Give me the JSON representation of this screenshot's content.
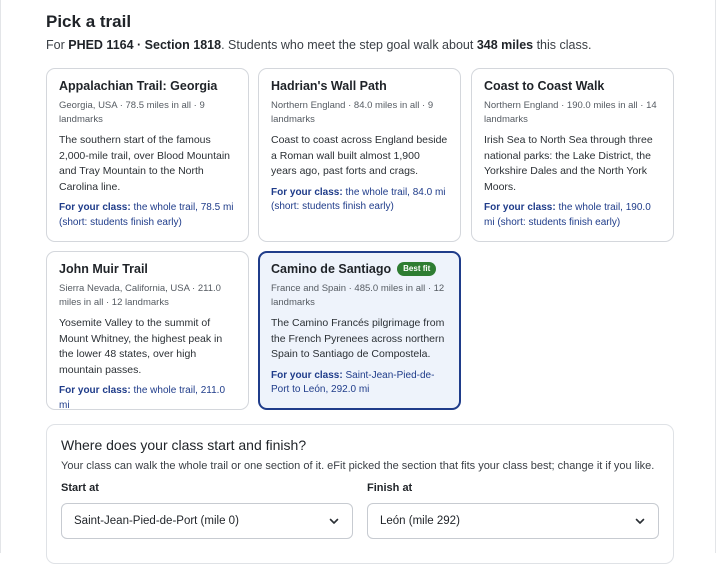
{
  "header": {
    "title": "Pick a trail",
    "sub_prefix": "For ",
    "course": "PHED 1164 · Section 1818",
    "sub_middle": ". Students who meet the step goal walk about ",
    "miles": "348 miles",
    "sub_suffix": " this class."
  },
  "trails": [
    {
      "name": "Appalachian Trail: Georgia",
      "meta": "Georgia, USA · 78.5 miles in all · 9 landmarks",
      "desc": "The southern start of the famous 2,000-mile trail, over Blood Mountain and Tray Mountain to the North Carolina line.",
      "class_label": "For your class:",
      "class_value": "the whole trail, 78.5 mi (short: students finish early)"
    },
    {
      "name": "Hadrian's Wall Path",
      "meta": "Northern England · 84.0 miles in all · 9 landmarks",
      "desc": "Coast to coast across England beside a Roman wall built almost 1,900 years ago, past forts and crags.",
      "class_label": "For your class:",
      "class_value": "the whole trail, 84.0 mi (short: students finish early)"
    },
    {
      "name": "Coast to Coast Walk",
      "meta": "Northern England · 190.0 miles in all · 14 landmarks",
      "desc": "Irish Sea to North Sea through three national parks: the Lake District, the Yorkshire Dales and the North York Moors.",
      "class_label": "For your class:",
      "class_value": "the whole trail, 190.0 mi (short: students finish early)"
    },
    {
      "name": "John Muir Trail",
      "meta": "Sierra Nevada, California, USA · 211.0 miles in all · 12 landmarks",
      "desc": "Yosemite Valley to the summit of Mount Whitney, the highest peak in the lower 48 states, over high mountain passes.",
      "class_label": "For your class:",
      "class_value": "the whole trail, 211.0 mi"
    },
    {
      "name": "Camino de Santiago",
      "badge": "Best fit",
      "meta": "France and Spain · 485.0 miles in all · 12 landmarks",
      "desc": "The Camino Francés pilgrimage from the French Pyrenees across northern Spain to Santiago de Compostela.",
      "class_label": "For your class:",
      "class_value": "Saint-Jean-Pied-de-Port to León, 292.0 mi"
    }
  ],
  "route": {
    "title": "Where does your class start and finish?",
    "subtitle": "Your class can walk the whole trail or one section of it. eFit picked the section that fits your class best; change it if you like.",
    "start_label": "Start at",
    "start_value": "Saint-Jean-Pied-de-Port (mile 0)",
    "finish_label": "Finish at",
    "finish_value": "León (mile 292)"
  },
  "icons": {
    "dropdown": "chevron-down-icon"
  },
  "colors": {
    "accent": "#1f3c8a",
    "badge": "#2e7d32",
    "selected_bg": "#eef3fb"
  }
}
